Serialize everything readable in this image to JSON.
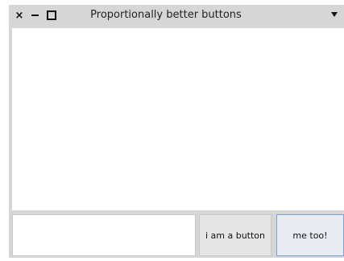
{
  "window": {
    "title": "Proportionally better buttons",
    "close_glyph": "×",
    "icons": [
      "close-icon",
      "minimize-icon",
      "maximize-icon",
      "window-menu-icon"
    ]
  },
  "form": {
    "text_value": "",
    "button_primary_label": "i am a button",
    "button_secondary_label": "me too!"
  },
  "colors": {
    "window_chrome": "#d6d6d6",
    "content_bg": "#ffffff",
    "focused_button_border": "#7fa2d6"
  }
}
